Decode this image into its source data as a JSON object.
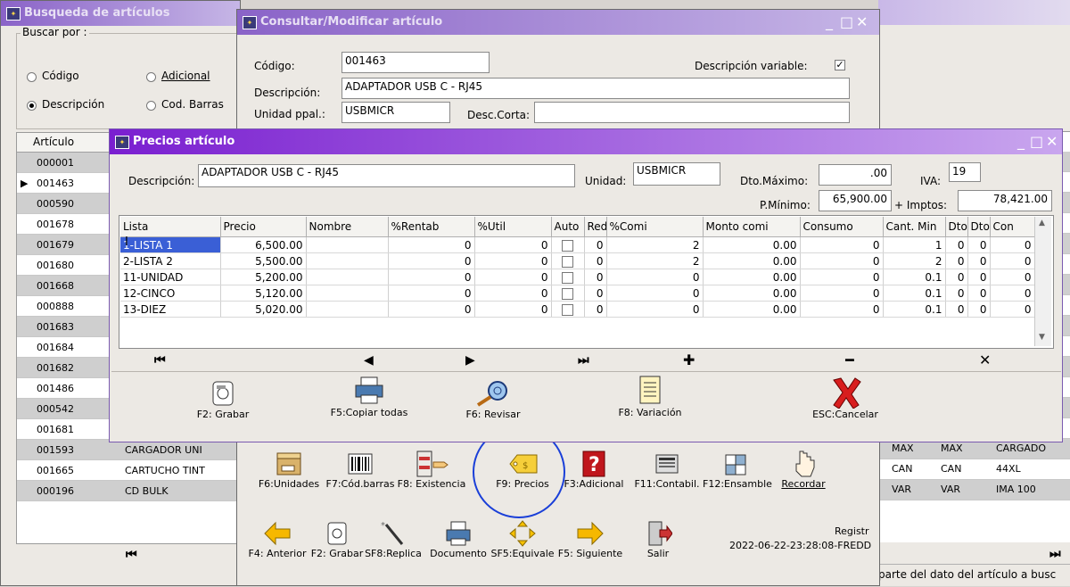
{
  "search_window": {
    "title": "Busqueda de artículos",
    "buscar_por": "Buscar por :",
    "opts": {
      "codigo": "Código",
      "adicional": "Adicional",
      "descripcion": "Descripción",
      "cod_barras": "Cod. Barras"
    },
    "col_articulo": "Artículo",
    "codes": [
      "000001",
      "001463",
      "000590",
      "001678",
      "001679",
      "001680",
      "001668",
      "000888",
      "001683",
      "001684",
      "001682",
      "001486",
      "000542",
      "001681",
      "001593",
      "001665",
      "000196"
    ],
    "right_rows": [
      {
        "c1": "MAX",
        "c2": "MAX",
        "c3": "CARGADO"
      },
      {
        "c1": "CAN",
        "c2": "CAN",
        "c3": "44XL"
      },
      {
        "c1": "VAR",
        "c2": "VAR",
        "c3": "IMA 100"
      }
    ],
    "partial_rows": [
      "CARGADOR UNI",
      "CARTUCHO TINT",
      "CD BULK"
    ],
    "status_text": "parte del dato del artículo a busc"
  },
  "consult_window": {
    "title": "Consultar/Modificar artículo",
    "codigo_label": "Código:",
    "codigo": "001463",
    "desc_var_label": "Descripción variable:",
    "desc_var_check": "✓",
    "descripcion_label": "Descripción:",
    "descripcion": "ADAPTADOR USB C - RJ45",
    "unidad_label": "Unidad ppal.:",
    "unidad": "USBMICR",
    "desc_corta_label": "Desc.Corta:",
    "toolbar1": [
      "F6:Unidades",
      "F7:Cód.barras",
      "F8: Existencia",
      "F9: Precios",
      "F3:Adicional",
      "F11:Contabil.",
      "F12:Ensamble",
      "Recordar"
    ],
    "toolbar2": [
      "F4: Anterior",
      "F2: Grabar",
      "SF8:Replica",
      "Documento",
      "SF5:Equivale",
      "F5: Siguiente",
      "Salir"
    ],
    "registro_label": "Registr",
    "registro": "2022-06-22-23:28:08-FREDD"
  },
  "prices_window": {
    "title": "Precios artículo",
    "descripcion_label": "Descripción:",
    "descripcion": "ADAPTADOR USB C - RJ45",
    "unidad_label": "Unidad:",
    "unidad": "USBMICR",
    "dto_max_label": "Dto.Máximo:",
    "dto_max": ".00",
    "iva_label": "IVA:",
    "iva": "19",
    "pmin_label": "P.Mínimo:",
    "pmin": "65,900.00",
    "imptos_label": "+ Imptos:",
    "imptos": "78,421.00",
    "columns": [
      "Lista",
      "Precio",
      "Nombre",
      "%Rentab",
      "%Util",
      "Auto",
      "Red",
      "%Comi",
      "Monto comi",
      "Consumo",
      "Cant. Min",
      "Dto.",
      "Dto.",
      "Con"
    ],
    "rows": [
      {
        "lista": "1-LISTA 1",
        "precio": "6,500.00",
        "rentab": "0",
        "util": "0",
        "red": "0",
        "comi": "2",
        "monto": "0.00",
        "consumo": "0",
        "cant": "1",
        "d1": "0",
        "d2": "0",
        "con": "0"
      },
      {
        "lista": "2-LISTA 2",
        "precio": "5,500.00",
        "rentab": "0",
        "util": "0",
        "red": "0",
        "comi": "2",
        "monto": "0.00",
        "consumo": "0",
        "cant": "2",
        "d1": "0",
        "d2": "0",
        "con": "0"
      },
      {
        "lista": "11-UNIDAD",
        "precio": "5,200.00",
        "rentab": "0",
        "util": "0",
        "red": "0",
        "comi": "0",
        "monto": "0.00",
        "consumo": "0",
        "cant": "0.1",
        "d1": "0",
        "d2": "0",
        "con": "0"
      },
      {
        "lista": "12-CINCO",
        "precio": "5,120.00",
        "rentab": "0",
        "util": "0",
        "red": "0",
        "comi": "0",
        "monto": "0.00",
        "consumo": "0",
        "cant": "0.1",
        "d1": "0",
        "d2": "0",
        "con": "0"
      },
      {
        "lista": "13-DIEZ",
        "precio": "5,020.00",
        "rentab": "0",
        "util": "0",
        "red": "0",
        "comi": "0",
        "monto": "0.00",
        "consumo": "0",
        "cant": "0.1",
        "d1": "0",
        "d2": "0",
        "con": "0"
      }
    ],
    "buttons": [
      "F2: Grabar",
      "F5:Copiar todas",
      "F6: Revisar",
      "F8: Variación",
      "ESC:Cancelar"
    ]
  },
  "colors": {
    "title_grad_a": "#7a1fd0",
    "title_grad_b": "#c9a6ee",
    "highlight": "#3a5fd6",
    "circle": "#1a3fd8"
  }
}
